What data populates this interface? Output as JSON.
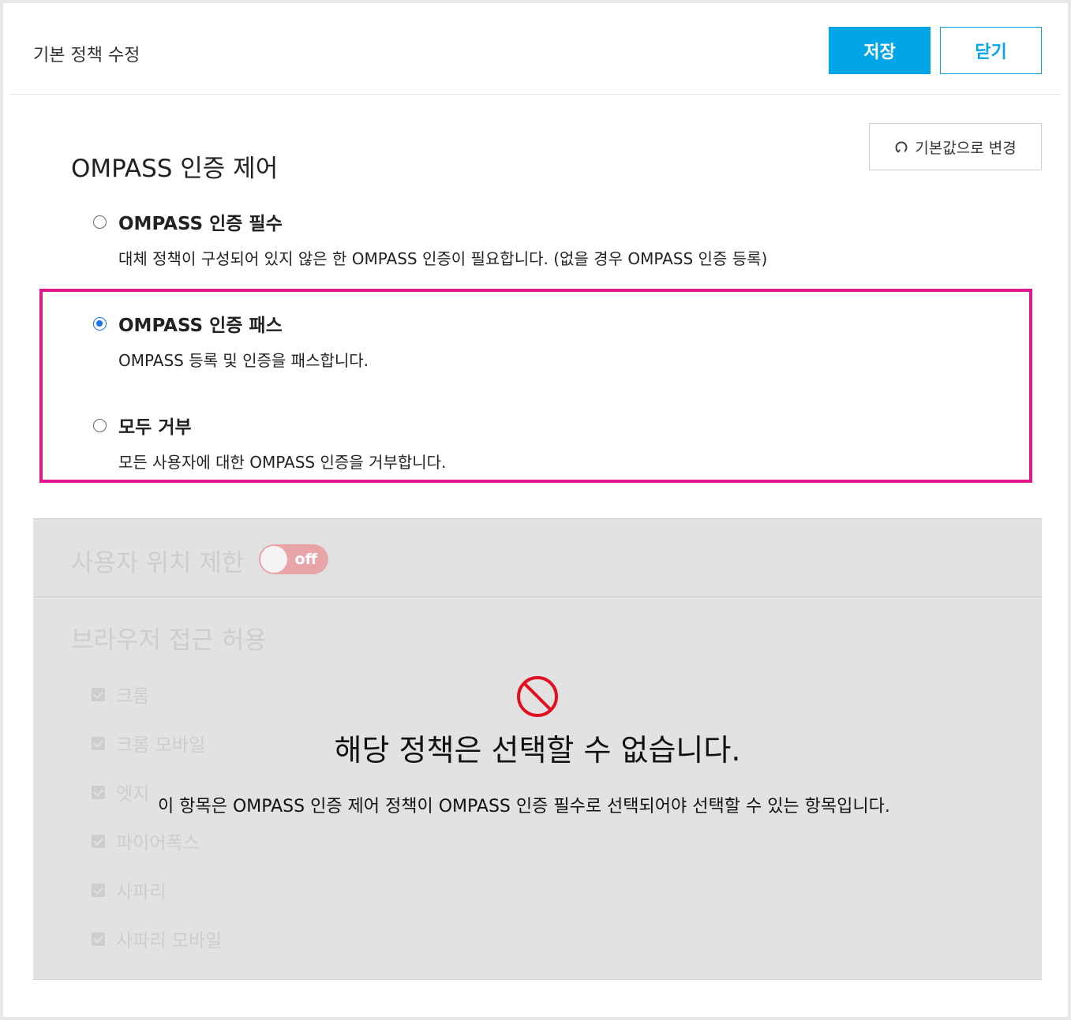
{
  "header": {
    "title": "기본 정책 수정",
    "save_label": "저장",
    "close_label": "닫기"
  },
  "reset_button": {
    "label": "기본값으로 변경",
    "icon": "reset-icon"
  },
  "auth_control": {
    "title": "OMPASS 인증 제어",
    "options": [
      {
        "label": "OMPASS 인증 필수",
        "description": "대체 정책이 구성되어 있지 않은 한 OMPASS 인증이 필요합니다. (없을 경우 OMPASS 인증 등록)",
        "selected": false
      },
      {
        "label": "OMPASS 인증 패스",
        "description": "OMPASS 등록 및 인증을 패스합니다.",
        "selected": true
      },
      {
        "label": "모두 거부",
        "description": "모든 사용자에 대한 OMPASS 인증을 거부합니다.",
        "selected": false
      }
    ],
    "highlight_color": "#e0188c"
  },
  "location_limit": {
    "title": "사용자 위치 제한",
    "toggle_label": "off",
    "enabled": false
  },
  "browser_access": {
    "title": "브라우저 접근 허용",
    "items": [
      {
        "label": "크롬",
        "checked": true
      },
      {
        "label": "크롬 모바일",
        "checked": true
      },
      {
        "label": "엣지",
        "checked": true
      },
      {
        "label": "파이어폭스",
        "checked": true
      },
      {
        "label": "사파리",
        "checked": true
      },
      {
        "label": "사파리 모바일",
        "checked": true
      }
    ]
  },
  "disabled_overlay": {
    "icon": "prohibited-icon",
    "title": "해당 정책은 선택할 수 없습니다.",
    "description": "이 항목은 OMPASS 인증 제어 정책이 OMPASS 인증 필수로 선택되어야 선택할 수 있는 항목입니다."
  },
  "colors": {
    "primary": "#00a6e8",
    "radio_selected": "#1a73e8",
    "prohibited": "#e01020",
    "toggle_off": "#e8a5a8"
  }
}
